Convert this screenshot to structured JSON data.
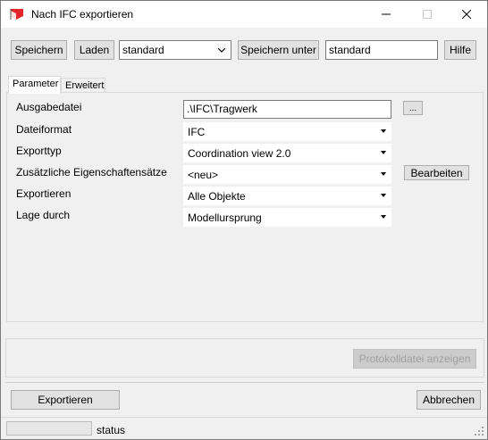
{
  "window": {
    "title": "Nach IFC exportieren",
    "minimize_glyph": "—",
    "maximize_glyph": "☐",
    "close_glyph": "✕"
  },
  "toolbar": {
    "save_label": "Speichern",
    "load_label": "Laden",
    "preset_value": "standard",
    "save_as_label": "Speichern unter",
    "save_as_value": "standard",
    "help_label": "Hilfe"
  },
  "tabs": [
    {
      "label": "Parameter",
      "active": true
    },
    {
      "label": "Erweitert",
      "active": false
    }
  ],
  "parameters": {
    "output_file": {
      "label": "Ausgabedatei",
      "value": ".\\IFC\\Tragwerk",
      "browse_label": "..."
    },
    "file_format": {
      "label": "Dateiformat",
      "value": "IFC"
    },
    "export_type": {
      "label": "Exporttyp",
      "value": "Coordination view 2.0"
    },
    "property_sets": {
      "label": "Zusätzliche Eigenschaftensätze",
      "value": "<neu>",
      "edit_label": "Bearbeiten"
    },
    "export": {
      "label": "Exportieren",
      "value": "Alle Objekte"
    },
    "position": {
      "label": "Lage durch",
      "value": "Modellursprung"
    }
  },
  "log_button_label": "Protokolldatei anzeigen",
  "footer": {
    "export_label": "Exportieren",
    "cancel_label": "Abbrechen"
  },
  "status": {
    "text": "status",
    "progress": 0
  },
  "colors": {
    "app_icon_red": "#e0262b",
    "button_face": "#e1e1e1",
    "window_bg": "#f0f0f0"
  }
}
